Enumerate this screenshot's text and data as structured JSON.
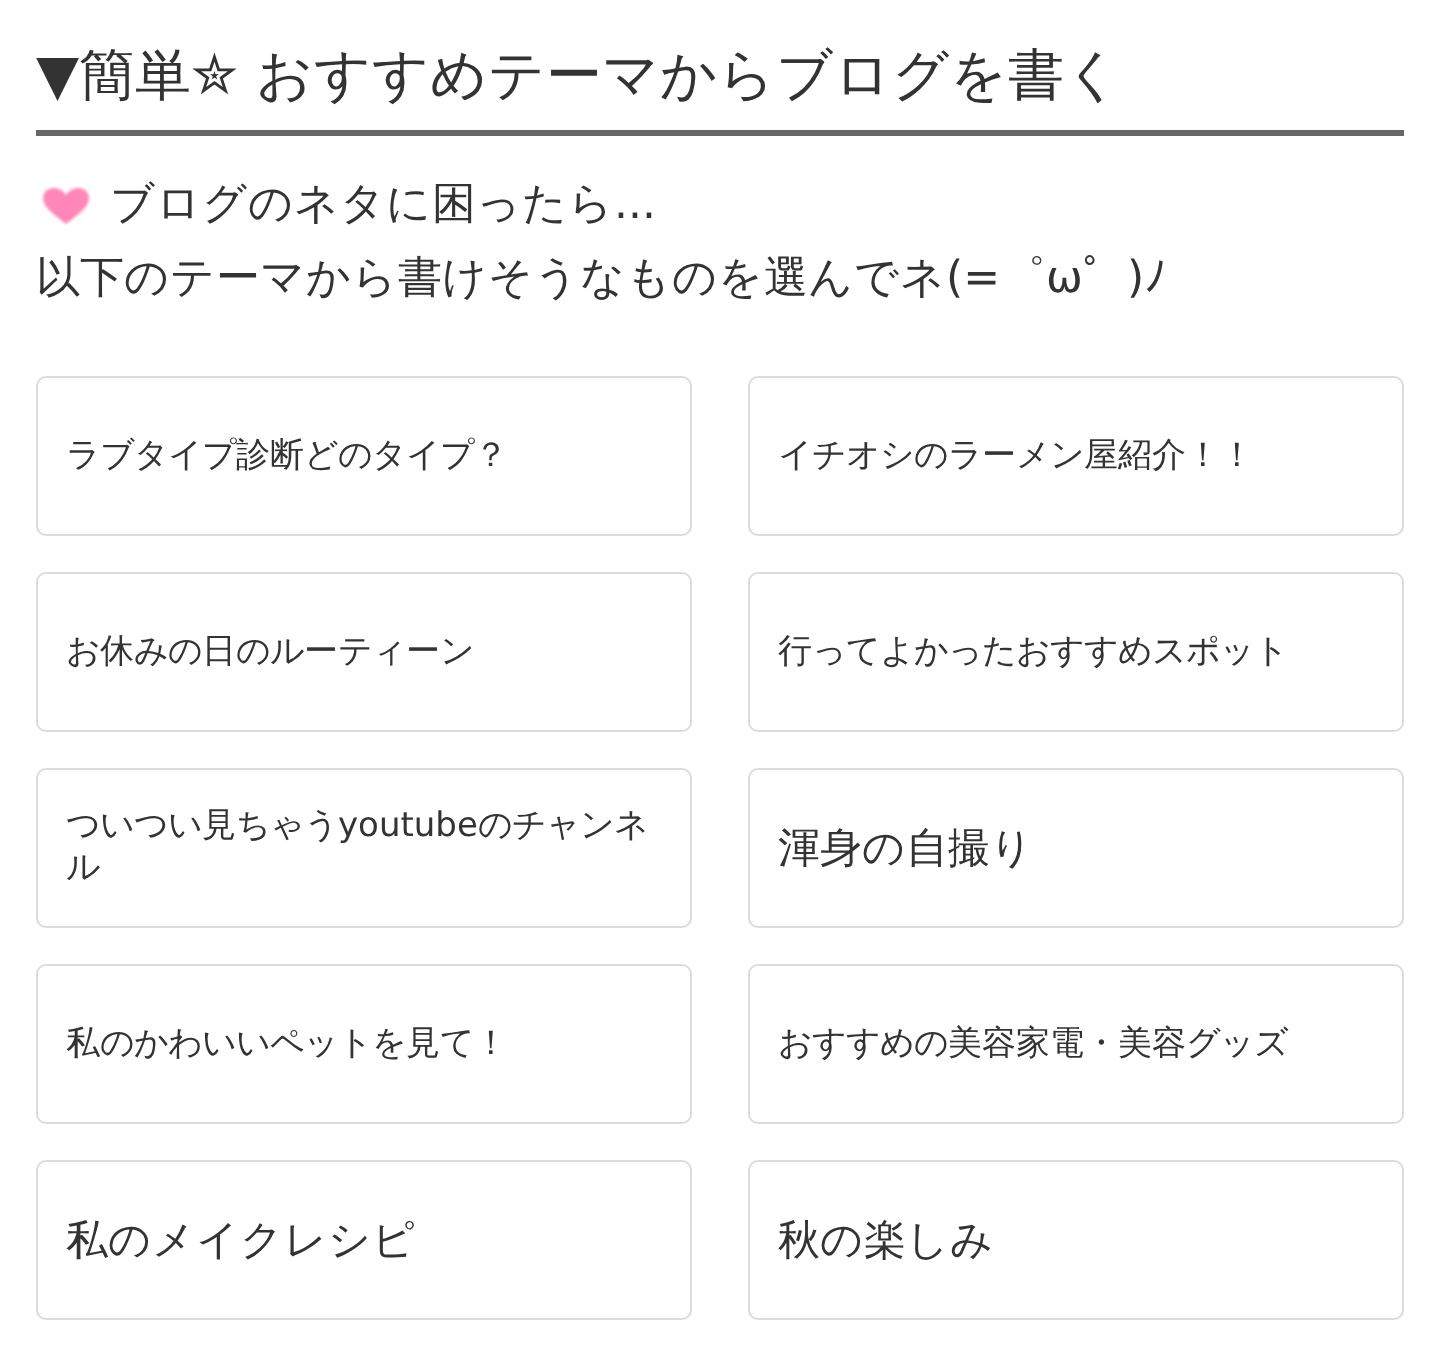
{
  "header": {
    "title": "▼簡単✮ おすすめテーマからブログを書く"
  },
  "intro": {
    "line_1": "ブログのネタに困ったら...",
    "line_2": "以下のテーマから書けそうなものを選んでネ(=゜ω゜)ﾉ"
  },
  "themes": [
    {
      "label": "ラブタイプ診断どのタイプ？",
      "kind": "normal"
    },
    {
      "label": "イチオシのラーメン屋紹介！！",
      "kind": "normal"
    },
    {
      "label": "お休みの日のルーティーン",
      "kind": "normal"
    },
    {
      "label": "行ってよかったおすすめスポット",
      "kind": "normal"
    },
    {
      "label": "ついつい見ちゃうyoutubeのチャンネル",
      "kind": "normal"
    },
    {
      "label": "渾身の自撮り",
      "kind": "large"
    },
    {
      "label": "私のかわいいペットを見て！",
      "kind": "normal"
    },
    {
      "label": "おすすめの美容家電・美容グッズ",
      "kind": "normal"
    },
    {
      "label": "私のメイクレシピ",
      "kind": "large"
    },
    {
      "label": "秋の楽しみ",
      "kind": "large"
    }
  ]
}
